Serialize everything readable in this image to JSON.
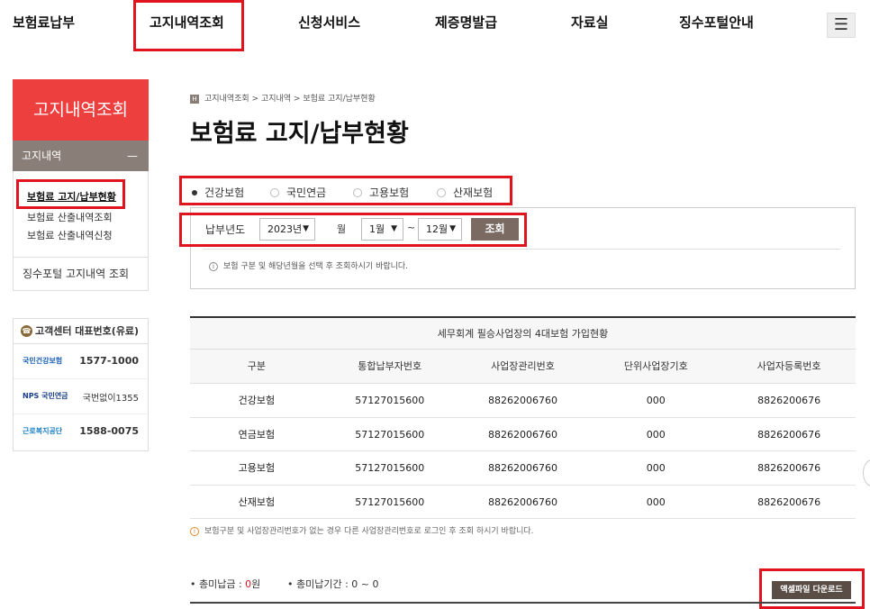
{
  "nav": {
    "items": [
      "보험료납부",
      "고지내역조회",
      "신청서비스",
      "제증명발급",
      "자료실",
      "징수포털안내"
    ],
    "menu_icon": "☰"
  },
  "sidebar": {
    "title": "고지내역조회",
    "section": "고지내역",
    "collapse_icon": "—",
    "links": [
      "보험료 고지/납부현황",
      "보험료 산출내역조회",
      "보험료 산출내역신청"
    ],
    "portal_link": "징수포털 고지내역 조회",
    "contact": {
      "title": "고객센터 대표번호(유료)",
      "rows": [
        {
          "logo": "국민건강보험",
          "number": "1577-1000"
        },
        {
          "logo": "NPS 국민연금",
          "number": "국번없이1355"
        },
        {
          "logo": "근로복지공단",
          "number": "1588-0075"
        }
      ]
    }
  },
  "breadcrumb": "고지내역조회 >  고지내역 >  보험료 고지/납부현황",
  "breadcrumb_icon": "H",
  "page_title": "보험료 고지/납부현황",
  "insurance_types": {
    "options": [
      "건강보험",
      "국민연금",
      "고용보험",
      "산재보험"
    ],
    "selected": "건강보험"
  },
  "search": {
    "label": "납부년도",
    "year": "2023년",
    "month_label": "월",
    "month_from": "1월",
    "tilde": "~",
    "month_to": "12월",
    "button": "조회",
    "note": "보험 구분 및 해당년월을 선택 후 조회하시기 바랍니다."
  },
  "table": {
    "caption": "세무회계 필승사업장의 4대보험 가입현황",
    "headers": [
      "구분",
      "통합납부자번호",
      "사업장관리번호",
      "단위사업장기호",
      "사업자등록번호"
    ],
    "rows": [
      [
        "건강보험",
        "57127015600",
        "88262006760",
        "000",
        "8826200676"
      ],
      [
        "연금보험",
        "57127015600",
        "88262006760",
        "000",
        "8826200676"
      ],
      [
        "고용보험",
        "57127015600",
        "88262006760",
        "000",
        "8826200676"
      ],
      [
        "산재보험",
        "57127015600",
        "88262006760",
        "000",
        "8826200676"
      ]
    ],
    "foot_note": "보험구분 및 사업장관리번호가 없는 경우 다른 사업장관리번호로 로그인 후 조회 하시기 바랍니다."
  },
  "arrears": {
    "amount_label": "• 총미납금 : ",
    "amount_value": "0",
    "amount_unit": "원",
    "period_label": "• 총미납기간 : 0 ~ 0"
  },
  "excel_button": "액셀파일 다운로드",
  "colors": {
    "accent_red": "#e0141e",
    "sidebar_title": "#ee3f3f",
    "button_brown": "#7a6a62"
  }
}
